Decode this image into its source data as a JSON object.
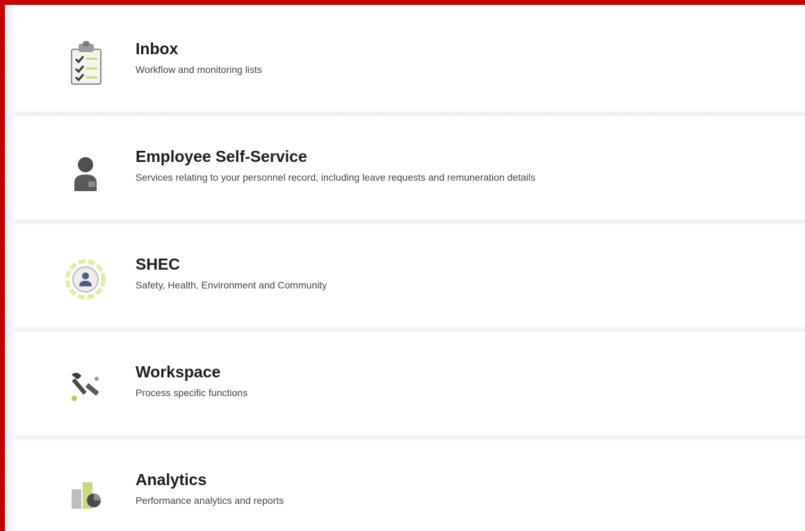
{
  "colors": {
    "frame_border": "#c80000",
    "title_text": "#1e1e1e",
    "description_text": "#444444"
  },
  "menu": {
    "items": [
      {
        "title": "Inbox",
        "description": "Workflow and monitoring lists",
        "icon": "checklist-clipboard-icon"
      },
      {
        "title": "Employee Self-Service",
        "description": "Services relating to your personnel record, including leave requests and remuneration details",
        "icon": "employee-person-icon"
      },
      {
        "title": "SHEC",
        "description": "Safety, Health, Environment and Community",
        "icon": "safety-gear-icon"
      },
      {
        "title": "Workspace",
        "description": "Process specific functions",
        "icon": "tools-wrench-icon"
      },
      {
        "title": "Analytics",
        "description": "Performance analytics and reports",
        "icon": "analytics-chart-icon"
      }
    ]
  }
}
